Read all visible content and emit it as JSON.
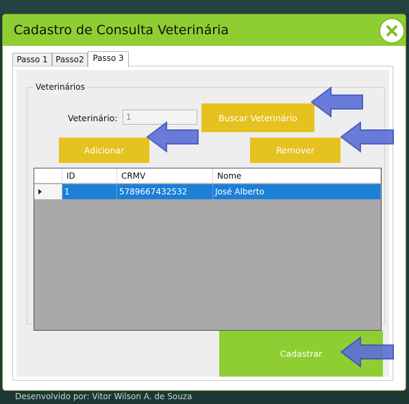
{
  "background_text": "Desenvolvido por: Vitor Wilson A. de Souza",
  "window": {
    "title": "Cadastro de Consulta Veterinária",
    "close_icon": "close-icon",
    "accent_color": "#8fce33"
  },
  "tabs": [
    {
      "label": "Passo 1",
      "active": false
    },
    {
      "label": "Passo2",
      "active": false
    },
    {
      "label": "Passo 3",
      "active": true
    }
  ],
  "group": {
    "title": "Veterinários",
    "vet_label": "Veterinário:",
    "vet_value": "1"
  },
  "buttons": {
    "search": "Buscar Veterinário",
    "add": "Adicionar",
    "remove": "Remover",
    "submit": "Cadastrar",
    "yellow_color": "#e6c220"
  },
  "grid": {
    "columns": [
      "ID",
      "CRMV",
      "Nome"
    ],
    "rows": [
      {
        "id": "1",
        "crmv": "5789667432532",
        "nome": "José Alberto",
        "selected": true
      }
    ],
    "selection_color": "#1c7fd8"
  },
  "annotation_arrow_color": "#5b6fd6"
}
